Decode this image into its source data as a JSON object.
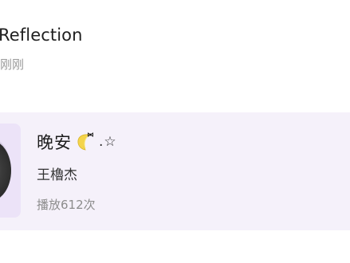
{
  "post": {
    "title": "Reflection",
    "time": "刚刚"
  },
  "song": {
    "title": "晚安",
    "title_decoration": ".☆",
    "title_emoji": "crescent-moon-with-bow",
    "artist": "王櫓杰",
    "plays": "播放612次"
  },
  "colors": {
    "card_background": "#f5f1fa",
    "moon": "#f4d44a"
  }
}
